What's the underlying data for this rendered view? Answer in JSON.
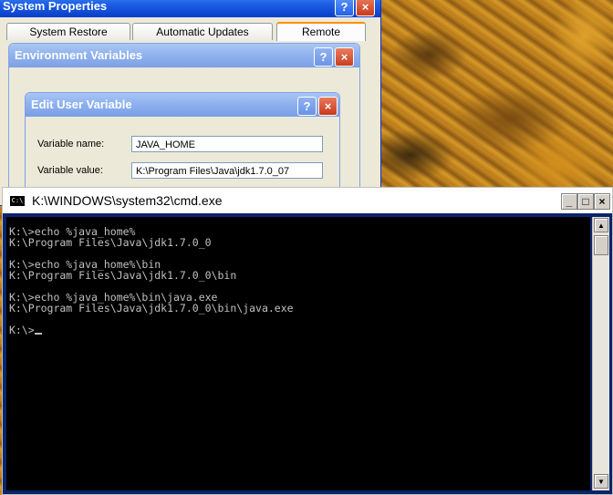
{
  "system_properties": {
    "title": "System Properties",
    "tabs": [
      {
        "label": "System Restore"
      },
      {
        "label": "Automatic Updates"
      },
      {
        "label": "Remote"
      }
    ]
  },
  "environment_variables": {
    "title": "Environment Variables"
  },
  "edit_user_variable": {
    "title": "Edit User Variable",
    "variable_name_label": "Variable name:",
    "variable_name_value": "JAVA_HOME",
    "variable_value_label": "Variable value:",
    "variable_value_value": "K:\\Program Files\\Java\\jdk1.7.0_07"
  },
  "cmd": {
    "title": "K:\\WINDOWS\\system32\\cmd.exe",
    "icon_text": "C:\\",
    "lines": [
      "K:\\>echo %java_home%",
      "K:\\Program Files\\Java\\jdk1.7.0_0",
      "",
      "K:\\>echo %java_home%\\bin",
      "K:\\Program Files\\Java\\jdk1.7.0_0\\bin",
      "",
      "K:\\>echo %java_home%\\bin\\java.exe",
      "K:\\Program Files\\Java\\jdk1.7.0_0\\bin\\java.exe",
      "",
      "K:\\>"
    ]
  },
  "icons": {
    "help": "?",
    "close": "×",
    "minimize": "_",
    "maximize": "□",
    "scroll_up": "▲",
    "scroll_down": "▼"
  }
}
